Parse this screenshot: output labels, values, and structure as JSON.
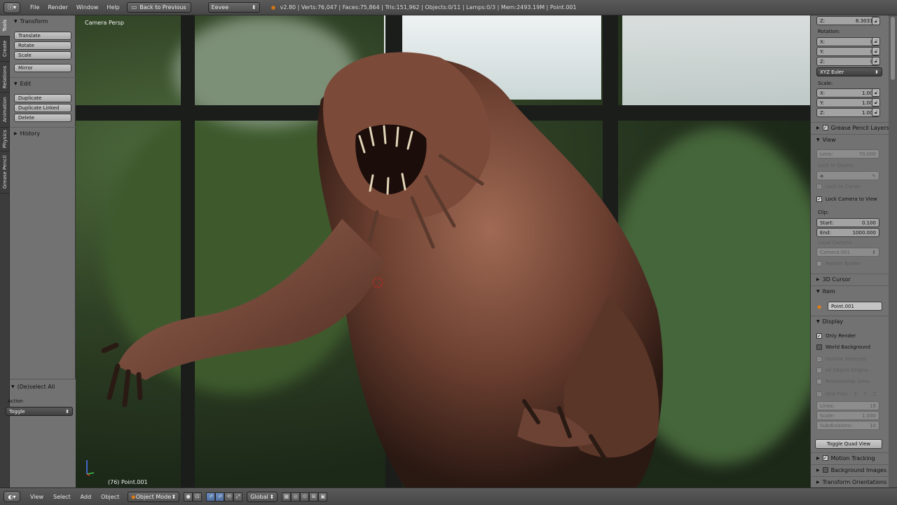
{
  "top": {
    "editor_icon": "info-editor-icon",
    "menus": [
      "File",
      "Render",
      "Window",
      "Help"
    ],
    "back_button": "Back to Previous",
    "engine": "Eevee",
    "stats": "v2.80 | Verts:76,047 | Faces:75,864 | Tris:151,962 | Objects:0/11 | Lamps:0/3 | Mem:2493.19M | Point.001"
  },
  "tabs": [
    "Tools",
    "Create",
    "Relations",
    "Animation",
    "Physics",
    "Grease Pencil"
  ],
  "toolshelf": {
    "transform_title": "Transform",
    "transform_buttons": [
      "Translate",
      "Rotate",
      "Scale"
    ],
    "mirror": "Mirror",
    "edit_title": "Edit",
    "edit_buttons": [
      "Duplicate",
      "Duplicate Linked",
      "Delete"
    ],
    "history_title": "History"
  },
  "operator": {
    "title": "(De)select All",
    "action_label": "Action",
    "action_value": "Toggle"
  },
  "viewport": {
    "view_name": "Camera Persp",
    "object_label": "(76) Point.001"
  },
  "props": {
    "loc_z": {
      "k": "Z:",
      "v": "6.30315"
    },
    "rotation_label": "Rotation:",
    "rotation": [
      {
        "k": "X:",
        "v": "0°"
      },
      {
        "k": "Y:",
        "v": "0°"
      },
      {
        "k": "Z:",
        "v": "0°"
      }
    ],
    "rotation_mode": "XYZ Euler",
    "scale_label": "Scale:",
    "scale": [
      {
        "k": "X:",
        "v": "1.000"
      },
      {
        "k": "Y:",
        "v": "1.000"
      },
      {
        "k": "Z:",
        "v": "1.000"
      }
    ],
    "grease_pencil_layers": "Grease Pencil Layers",
    "view_title": "View",
    "lens": {
      "k": "Lens:",
      "v": "70.000"
    },
    "lock_to_object": "Lock to Object:",
    "lock_to_cursor": "Lock to Cursor",
    "lock_camera_to_view": "Lock Camera to View",
    "clip_label": "Clip:",
    "clip_start": {
      "k": "Start:",
      "v": "0.100"
    },
    "clip_end": {
      "k": "End:",
      "v": "1000.000"
    },
    "local_camera_label": "Local Camera:",
    "local_camera": "Camera.001",
    "render_border": "Render Border",
    "cursor_title": "3D Cursor",
    "item_title": "Item",
    "item_name": "Point.001",
    "display_title": "Display",
    "only_render": "Only Render",
    "world_background": "World Background",
    "outline_selected": "Outline Selected",
    "all_object_origins": "All Object Origins",
    "relationship_lines": "Relationship Lines",
    "grid_floor": "Grid Floo",
    "grid_axes": [
      "X",
      "Y",
      "Z"
    ],
    "lines": {
      "k": "Lines:",
      "v": "16"
    },
    "grid_scale": {
      "k": "Scale:",
      "v": "1.000"
    },
    "subdivisions": {
      "k": "Subdivisions:",
      "v": "10"
    },
    "toggle_quad_view": "Toggle Quad View",
    "motion_tracking": "Motion Tracking",
    "background_images": "Background Images",
    "transform_orientations": "Transform Orientations"
  },
  "bottom": {
    "menus": [
      "View",
      "Select",
      "Add",
      "Object"
    ],
    "mode": "Object Mode",
    "orientation": "Global"
  },
  "colors": {
    "accent": "#e87d0d",
    "panel": "#727272",
    "header": "#4f4f4f",
    "cursor": "#e02020"
  }
}
